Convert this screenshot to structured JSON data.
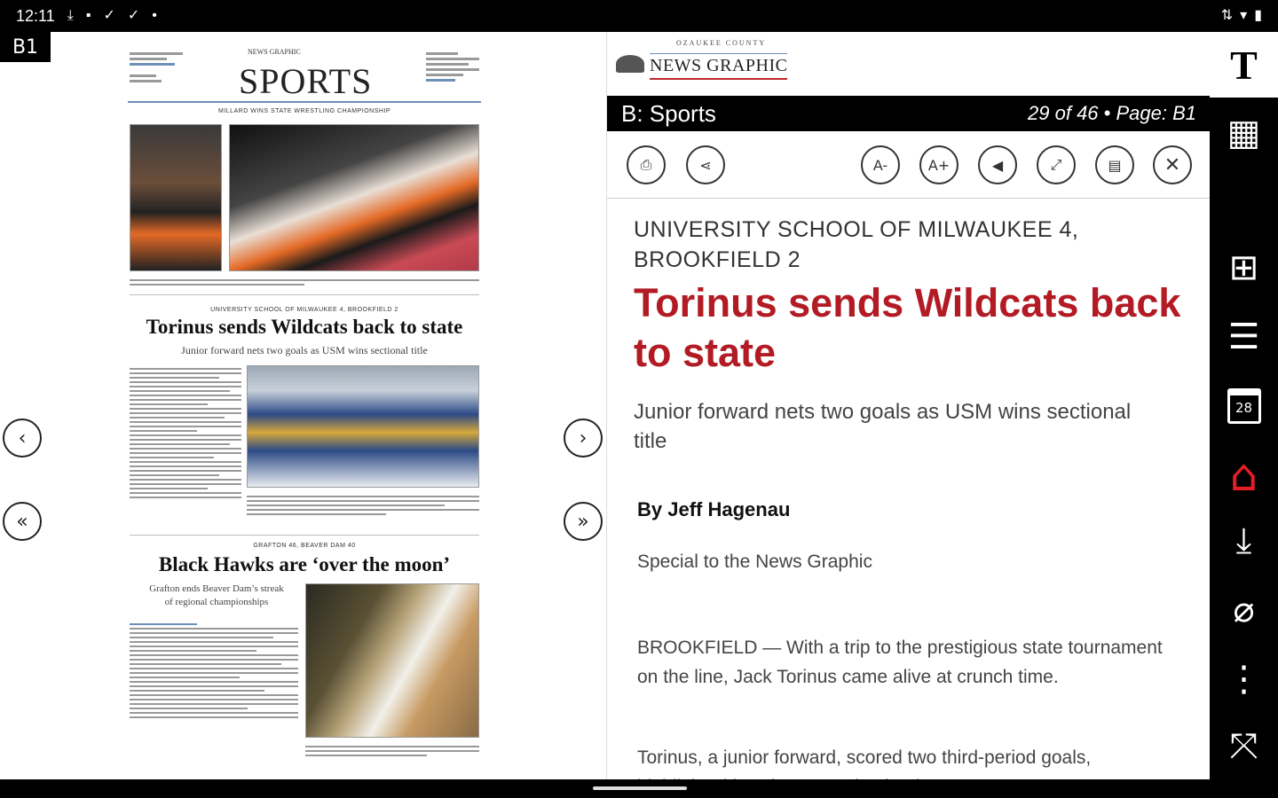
{
  "status": {
    "time": "12:11"
  },
  "page": {
    "badge": "B1",
    "newspaper": {
      "section_title": "SPORTS",
      "brand": "NEWS GRAPHIC",
      "kicker1": "MILLARD WINS STATE WRESTLING CHAMPIONSHIP",
      "kicker2": "UNIVERSITY SCHOOL OF MILWAUKEE 4, BROOKFIELD 2",
      "headline1": "Torinus sends Wildcats back to state",
      "sub1": "Junior forward nets two goals as USM wins sectional title",
      "kicker3": "GRAFTON 46, BEAVER DAM 40",
      "headline2": "Black Hawks are ‘over the moon’",
      "sub2a": "Grafton ends Beaver Dam’s streak",
      "sub2b": "of regional championships"
    }
  },
  "reader": {
    "logo_top": "OZAUKEE COUNTY",
    "logo_name": "NEWS GRAPHIC",
    "section": "B: Sports",
    "position": "29 of 46 • Page: B1",
    "toolbar": {
      "print_icon": "print-icon",
      "share_icon": "share-icon",
      "font_smaller": "A-",
      "font_larger": "A+",
      "audio_icon": "speaker-icon",
      "expand_icon": "expand-icon",
      "page_view_icon": "page-view-icon",
      "close_icon": "close-icon"
    },
    "article": {
      "kicker": "UNIVERSITY SCHOOL OF MILWAUKEE 4, BROOKFIELD 2",
      "headline": "Torinus sends Wildcats back to state",
      "dek": "Junior forward nets two goals as USM wins sectional title",
      "byline": "By Jeff Hagenau",
      "credit": "Special to the News Graphic",
      "para1": "BROOKFIELD — With a trip to the prestigious state tournament on the line, Jack Torinus came alive at crunch time.",
      "para2": "Torinus, a junior forward, scored two third-period goals, highlighted by what proved to be the game-"
    }
  },
  "rail": {
    "text_button": "T",
    "calendar_day": "28"
  },
  "colors": {
    "headline_red": "#b31b24",
    "home_red": "#e01f26"
  }
}
